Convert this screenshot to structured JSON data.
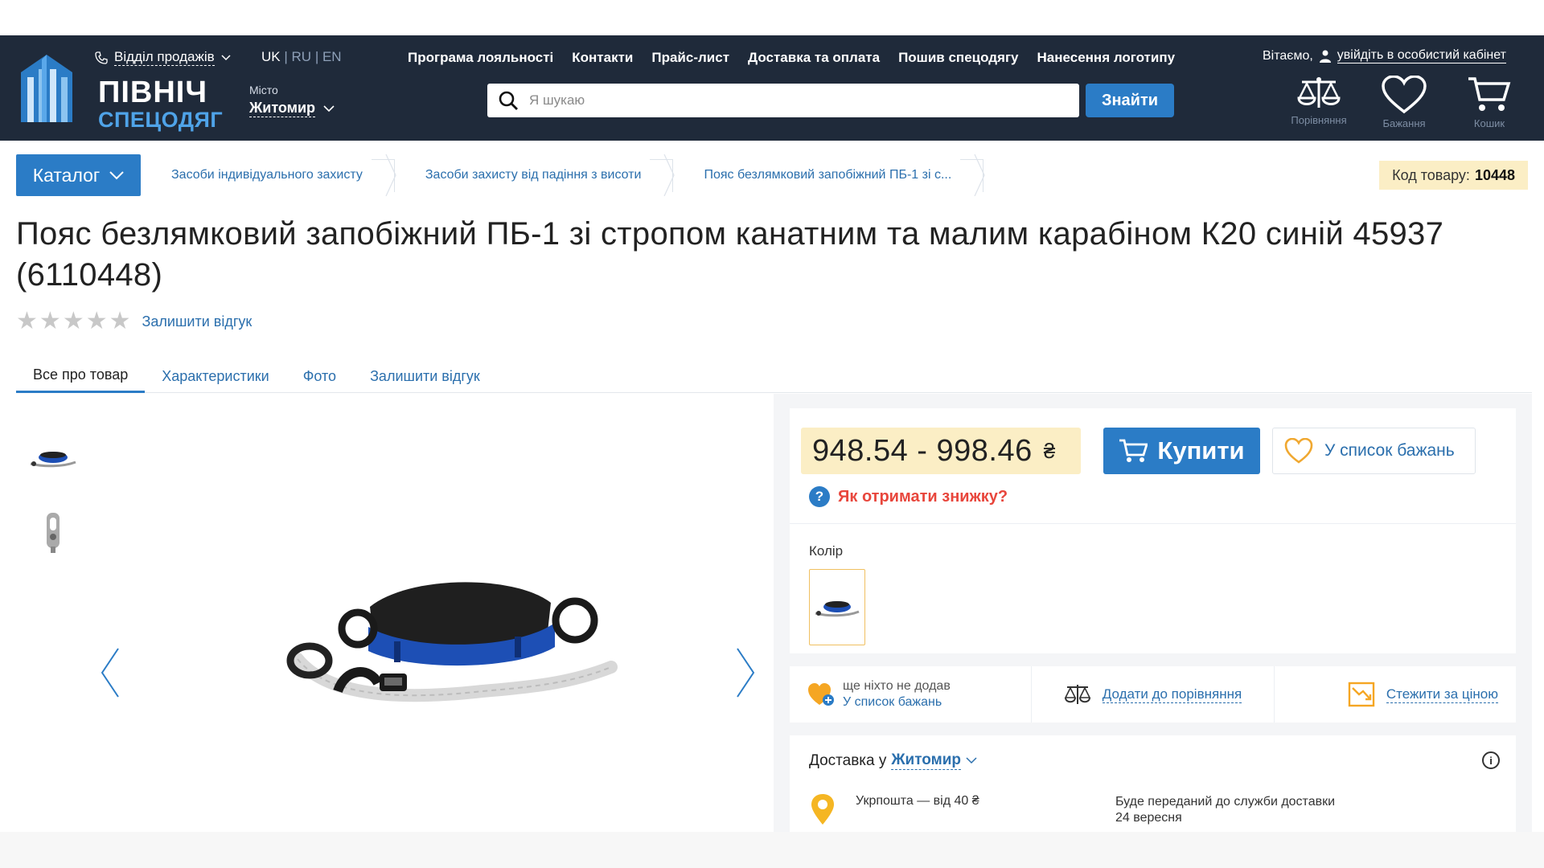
{
  "header": {
    "logo": {
      "line1": "ПІВНІЧ",
      "line2": "СПЕЦОДЯГ"
    },
    "sales_label": "Відділ продажів",
    "languages": {
      "uk": "UK",
      "ru": "RU",
      "en": "EN",
      "sep": "|"
    },
    "city": {
      "caption": "Місто",
      "value": "Житомир"
    },
    "nav": [
      "Програма лояльності",
      "Контакти",
      "Прайс-лист",
      "Доставка та оплата",
      "Пошив спецодягу",
      "Нанесення логотипу"
    ],
    "search": {
      "placeholder": "Я шукаю",
      "button": "Знайти"
    },
    "welcome": {
      "greeting": "Вітаємо,",
      "link": "увійдіть в особистий кабінет"
    },
    "icons": [
      {
        "name": "scales-icon",
        "label": "Порівняння"
      },
      {
        "name": "heart-icon",
        "label": "Бажання"
      },
      {
        "name": "cart-icon",
        "label": "Кошик"
      }
    ]
  },
  "breadcrumbs": {
    "catalog": "Каталог",
    "items": [
      "Засоби індивідуального захисту",
      "Засоби захисту від падіння з висоти",
      "Пояс безлямковий запобіжний ПБ-1 зі с..."
    ],
    "code_label": "Код товару:",
    "code_value": "10448"
  },
  "product": {
    "title": "Пояс безлямковий запобіжний ПБ-1 зі стропом канатним та малим карабіном К20 синій 45937 (6110448)",
    "rating": 0,
    "review_link": "Залишити відгук"
  },
  "tabs": [
    "Все про товар",
    "Характеристики",
    "Фото",
    "Залишити відгук"
  ],
  "buy_panel": {
    "price": "948.54 - 998.46",
    "currency": "₴",
    "buy_label": "Купити",
    "wishlist_label": "У список бажань",
    "discount_mark": "?",
    "discount_label": "Як отримати знижку?",
    "color_label": "Колір"
  },
  "actions": {
    "wish_line1": "ще ніхто не додав",
    "wish_line2": "У список бажань",
    "compare": "Додати до порівняння",
    "track": "Стежити за ціною"
  },
  "delivery": {
    "prefix": "Доставка у",
    "city": "Житомир",
    "info": "i",
    "service": "Укрпошта — від 40 ₴",
    "transfer_line1": "Буде переданий до служби доставки",
    "transfer_line2": "24 вересня"
  },
  "colors": {
    "header_bg": "#1f2a3a",
    "accent": "#2b7cc6",
    "price_bg": "#fbeec5",
    "discount": "#e8463c"
  }
}
